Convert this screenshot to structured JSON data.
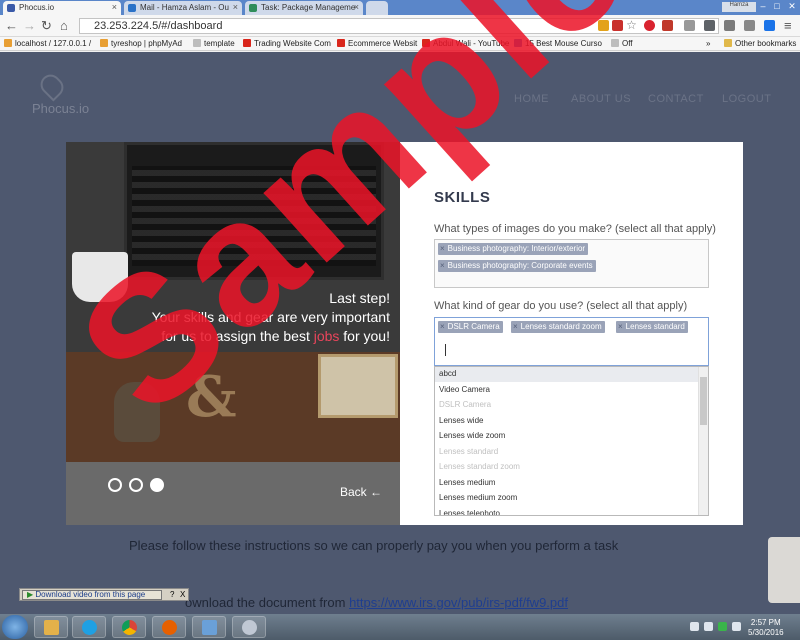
{
  "browser": {
    "tabs": [
      {
        "title": "Phocus.io",
        "icon_color": "#3a5aa8"
      },
      {
        "title": "Mail - Hamza Aslam - Ou",
        "icon_color": "#2a72c8"
      },
      {
        "title": "Task: Package Manageme",
        "icon_color": "#2f8d5a"
      }
    ],
    "user_chip": "Hamza",
    "url": "23.253.224.5/#/dashboard",
    "window_controls": [
      "–",
      "□",
      "✕"
    ],
    "bookmarks": [
      {
        "label": "localhost / 127.0.0.1 /",
        "icon_color": "#e89f34"
      },
      {
        "label": "tyreshop | phpMyAd",
        "icon_color": "#e89f34"
      },
      {
        "label": "template",
        "icon_color": "#bdbdbd"
      },
      {
        "label": "Trading Website Com",
        "icon_color": "#d9261c"
      },
      {
        "label": "Ecommerce Websit",
        "icon_color": "#d9261c"
      },
      {
        "label": "Abdul Wali - YouTube",
        "icon_color": "#d9261c"
      },
      {
        "label": "15 Best Mouse Curso",
        "icon_color": "#3b6fd8"
      },
      {
        "label": "Off",
        "icon_color": "#bdbdbd"
      },
      {
        "label": "»",
        "icon_color": ""
      },
      {
        "label": "Other bookmarks",
        "icon_color": "#e0b84a"
      }
    ]
  },
  "site": {
    "logo": "Phocus.io",
    "nav": [
      "HOME",
      "ABOUT US",
      "CONTACT",
      "LOGOUT"
    ],
    "instruction_1": "Please follow these instructions so we can properly pay you when you perform a task",
    "instruction_2_prefix": "ownload the document from",
    "instruction_2_link": "https://www.irs.gov/pub/irs-pdf/fw9.pdf"
  },
  "modal": {
    "overlay_line1": "Last step!",
    "overlay_line2": "Your skills and gear are very important",
    "overlay_line3_pre": "for us to assign the best ",
    "overlay_line3_accent": "jobs",
    "overlay_line3_post": " for you!",
    "back_label": "Back",
    "title": "SKILLS",
    "q1": "What types of images do you make? (select all that apply)",
    "q1_chips": [
      "Business photography: Interior/exterior",
      "Business photography: Corporate events"
    ],
    "q2": "What kind of gear do you use? (select all that apply)",
    "q2_chips": [
      "DSLR Camera",
      "Lenses standard zoom",
      "Lenses standard"
    ],
    "options": [
      {
        "label": "abcd",
        "state": "highlighted"
      },
      {
        "label": "Video Camera",
        "state": "normal"
      },
      {
        "label": "DSLR Camera",
        "state": "disabled"
      },
      {
        "label": "Lenses wide",
        "state": "normal"
      },
      {
        "label": "Lenses wide zoom",
        "state": "normal"
      },
      {
        "label": "Lenses standard",
        "state": "disabled"
      },
      {
        "label": "Lenses standard zoom",
        "state": "disabled"
      },
      {
        "label": "Lenses medium",
        "state": "normal"
      },
      {
        "label": "Lenses medium zoom",
        "state": "normal"
      },
      {
        "label": "Lenses telephoto",
        "state": "normal"
      }
    ],
    "slide_dots": 3
  },
  "download_bar": {
    "label": "Download video from this page",
    "help": "?",
    "close": "X"
  },
  "taskbar": {
    "time": "2:57 PM",
    "date": "5/30/2016"
  },
  "watermark": "Sample",
  "colors": {
    "accent": "#e8455b",
    "page_bg": "#4e586f",
    "chip": "#9aa3b8"
  }
}
